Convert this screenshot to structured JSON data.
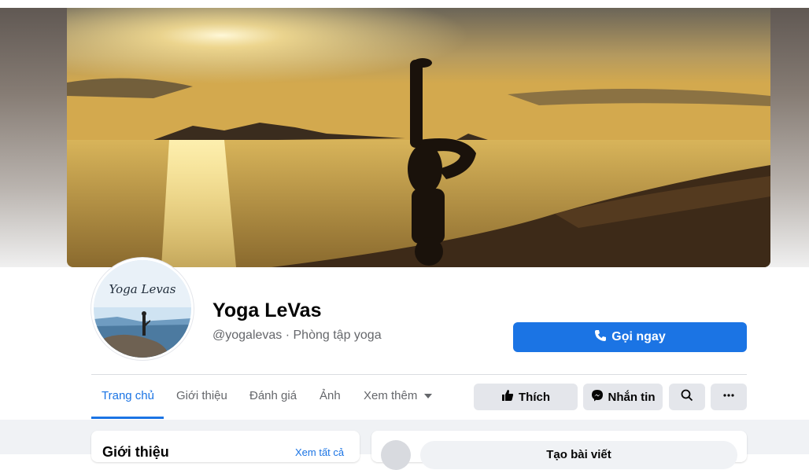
{
  "page": {
    "name": "Yoga LeVas",
    "subtitle": "@yogalevas · Phòng tập yoga",
    "avatar_text": "Yoga Levas"
  },
  "actions": {
    "call_label": "Gọi ngay",
    "like_label": "Thích",
    "message_label": "Nhắn tin",
    "search_icon": "search-icon",
    "more_icon": "more-dots-icon"
  },
  "tabs": [
    {
      "label": "Trang chủ",
      "active": true
    },
    {
      "label": "Giới thiệu",
      "active": false
    },
    {
      "label": "Đánh giá",
      "active": false
    },
    {
      "label": "Ảnh",
      "active": false
    },
    {
      "label": "Xem thêm",
      "active": false
    }
  ],
  "intro": {
    "title": "Giới thiệu",
    "see_all": "Xem tất cả"
  },
  "composer": {
    "button_label": "Tạo bài viết"
  },
  "colors": {
    "accent": "#1b74e4",
    "button_gray": "#e4e6eb",
    "muted_text": "#65676b"
  }
}
